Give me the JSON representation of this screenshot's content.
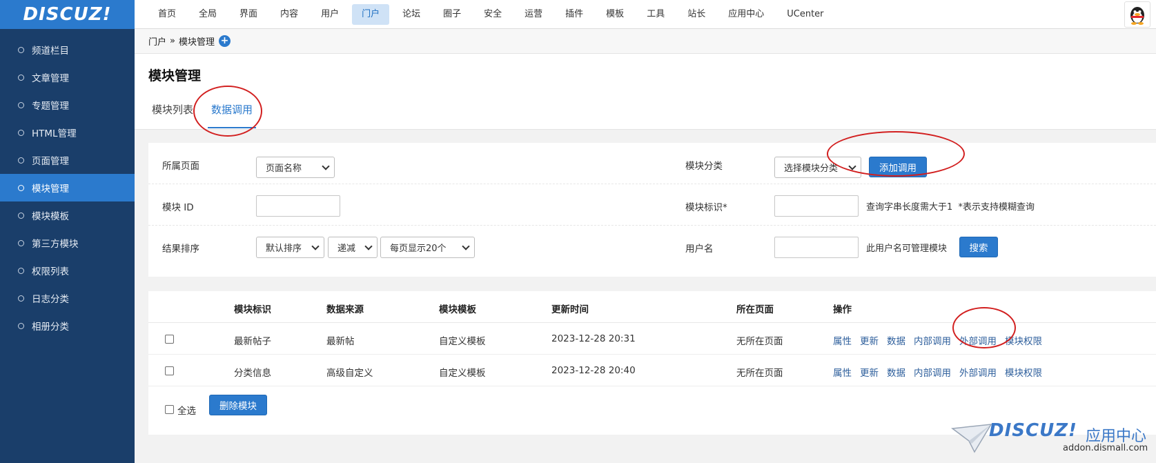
{
  "app": {
    "logo": "DISCUZ!"
  },
  "topnav": {
    "items": [
      "首页",
      "全局",
      "界面",
      "内容",
      "用户",
      "门户",
      "论坛",
      "圈子",
      "安全",
      "运营",
      "插件",
      "模板",
      "工具",
      "站长",
      "应用中心",
      "UCenter"
    ],
    "active_index": 5
  },
  "sidebar": {
    "items": [
      "频道栏目",
      "文章管理",
      "专题管理",
      "HTML管理",
      "页面管理",
      "模块管理",
      "模块模板",
      "第三方模块",
      "权限列表",
      "日志分类",
      "相册分类"
    ],
    "active_index": 5
  },
  "breadcrumb": {
    "root": "门户",
    "sep": "»",
    "current": "模块管理",
    "add": "+"
  },
  "page": {
    "title": "模块管理",
    "tabs": [
      "模块列表",
      "数据调用"
    ],
    "active_tab": 1
  },
  "filter": {
    "page_label": "所属页面",
    "page_select": "页面名称",
    "category_label": "模块分类",
    "category_select": "选择模块分类",
    "add_button": "添加调用",
    "id_label": "模块 ID",
    "ident_label": "模块标识*",
    "ident_hint": "查询字串长度需大于1  *表示支持模糊查询",
    "sort_label": "结果排序",
    "sort_select": "默认排序",
    "order_select": "递减",
    "perpage_select": "每页显示20个",
    "user_label": "用户名",
    "user_hint": "此用户名可管理模块",
    "search_button": "搜索"
  },
  "table": {
    "headers": [
      "模块标识",
      "数据来源",
      "模块模板",
      "更新时间",
      "所在页面",
      "操作"
    ],
    "rows": [
      {
        "ident": "最新帖子",
        "source": "最新帖",
        "template": "自定义模板",
        "time": "2023-12-28 20:31",
        "page": "无所在页面"
      },
      {
        "ident": "分类信息",
        "source": "高级自定义",
        "template": "自定义模板",
        "time": "2023-12-28 20:40",
        "page": "无所在页面"
      }
    ],
    "ops": [
      "属性",
      "更新",
      "数据",
      "内部调用",
      "外部调用",
      "模块权限"
    ],
    "select_all": "全选",
    "delete_button": "删除模块"
  },
  "watermark": {
    "logo": "DISCUZ!",
    "cn": "应用中心",
    "url": "addon.dismall.com"
  },
  "colors": {
    "accent": "#2b7acd",
    "sidebar": "#1a3e6a",
    "annotation": "#d21f1f"
  }
}
